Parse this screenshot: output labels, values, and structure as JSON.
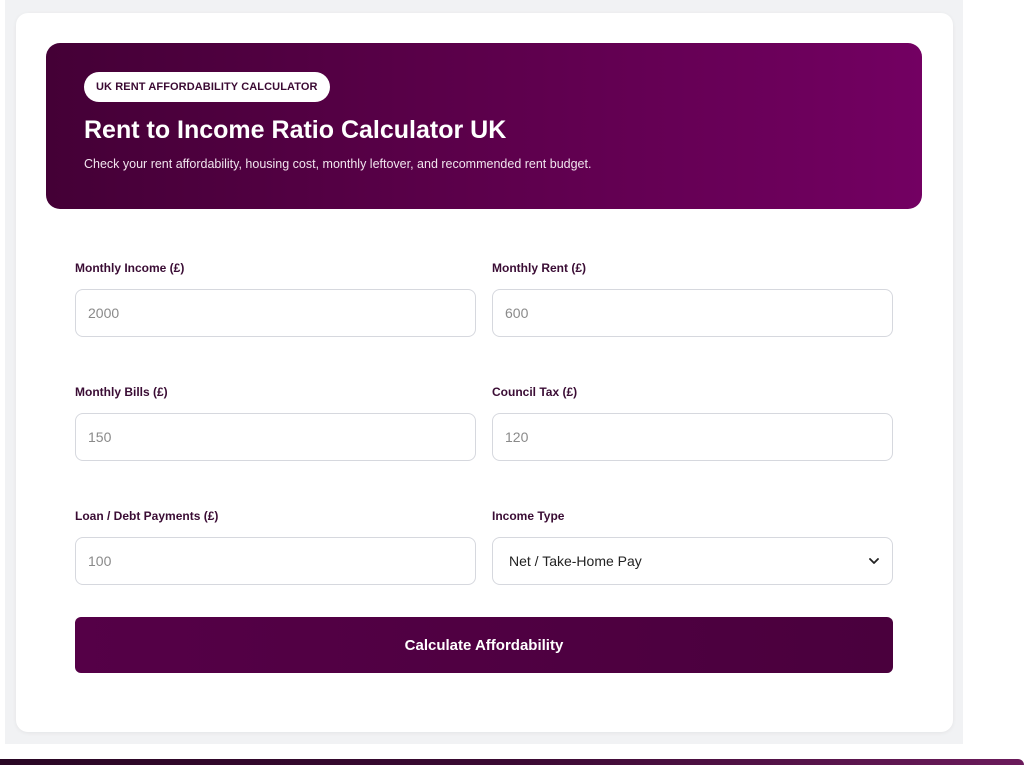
{
  "hero": {
    "badge": "UK RENT AFFORDABILITY CALCULATOR",
    "title": "Rent to Income Ratio Calculator UK",
    "subtitle": "Check your rent affordability, housing cost, monthly leftover, and recommended rent budget."
  },
  "form": {
    "monthly_income": {
      "label": "Monthly Income (£)",
      "placeholder": "2000"
    },
    "monthly_rent": {
      "label": "Monthly Rent (£)",
      "placeholder": "600"
    },
    "monthly_bills": {
      "label": "Monthly Bills (£)",
      "placeholder": "150"
    },
    "council_tax": {
      "label": "Council Tax (£)",
      "placeholder": "120"
    },
    "loan_debt": {
      "label": "Loan / Debt Payments (£)",
      "placeholder": "100"
    },
    "income_type": {
      "label": "Income Type",
      "selected": "Net / Take-Home Pay"
    }
  },
  "actions": {
    "calculate_label": "Calculate Affordability"
  },
  "colors": {
    "brand": "#550047",
    "brand_light": "#730062",
    "label_text": "#3a0c34"
  },
  "icons": {
    "dropdown": "chevron-down-icon"
  }
}
